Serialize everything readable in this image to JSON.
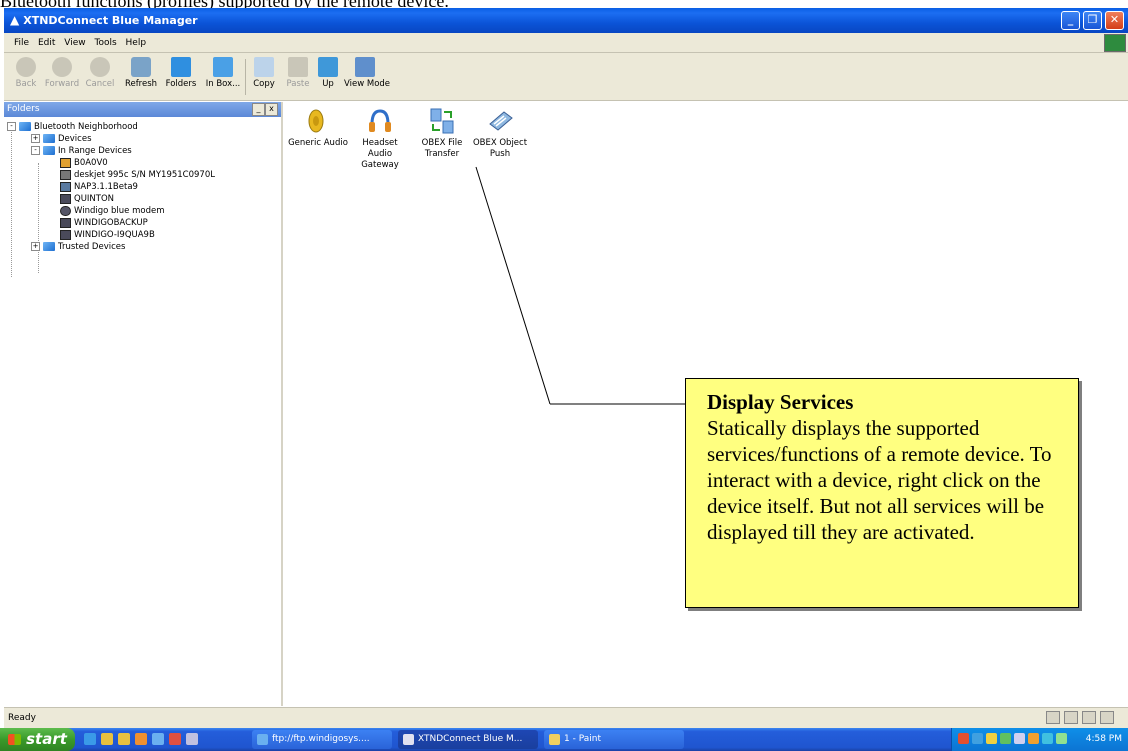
{
  "document": {
    "caption": "Bluetooth functions (profiles) supported by the remote device."
  },
  "window": {
    "title": "XTNDConnect Blue Manager"
  },
  "menu": [
    "File",
    "Edit",
    "View",
    "Tools",
    "Help"
  ],
  "toolbar": {
    "back": "Back",
    "forward": "Forward",
    "cancel": "Cancel",
    "refresh": "Refresh",
    "folders": "Folders",
    "inbox": "In Box...",
    "copy": "Copy",
    "paste": "Paste",
    "up": "Up",
    "view_mode": "View Mode"
  },
  "folders_pane": {
    "header": "Folders",
    "tree": {
      "root": "Bluetooth Neighborhood",
      "devices": "Devices",
      "in_range": "In Range Devices",
      "items": [
        "B0A0V0",
        "deskjet 995c S/N MY1951C0970L",
        "NAP3.1.1Beta9",
        "QUINTON",
        "Windigo blue modem",
        "WINDIGOBACKUP",
        "WINDIGO-I9QUA9B"
      ],
      "trusted": "Trusted Devices"
    }
  },
  "services": [
    {
      "label1": "Generic Audio",
      "label2": ""
    },
    {
      "label1": "Headset Audio",
      "label2": "Gateway"
    },
    {
      "label1": "OBEX File",
      "label2": "Transfer"
    },
    {
      "label1": "OBEX Object",
      "label2": "Push"
    }
  ],
  "callout": {
    "title": "Display Services",
    "body": "Statically displays the supported services/functions of a remote device.  To interact with a device, right click on the device itself.  But not all services will be displayed till they are activated."
  },
  "status": {
    "text": "Ready"
  },
  "taskbar": {
    "start": "start",
    "tasks": [
      "ftp://ftp.windigosys....",
      "XTNDConnect Blue M...",
      "1 - Paint"
    ],
    "clock": "4:58 PM"
  },
  "colors": {
    "callout_bg": "#ffff80",
    "titlebar": "#0b54d8",
    "taskbar": "#245edb"
  }
}
